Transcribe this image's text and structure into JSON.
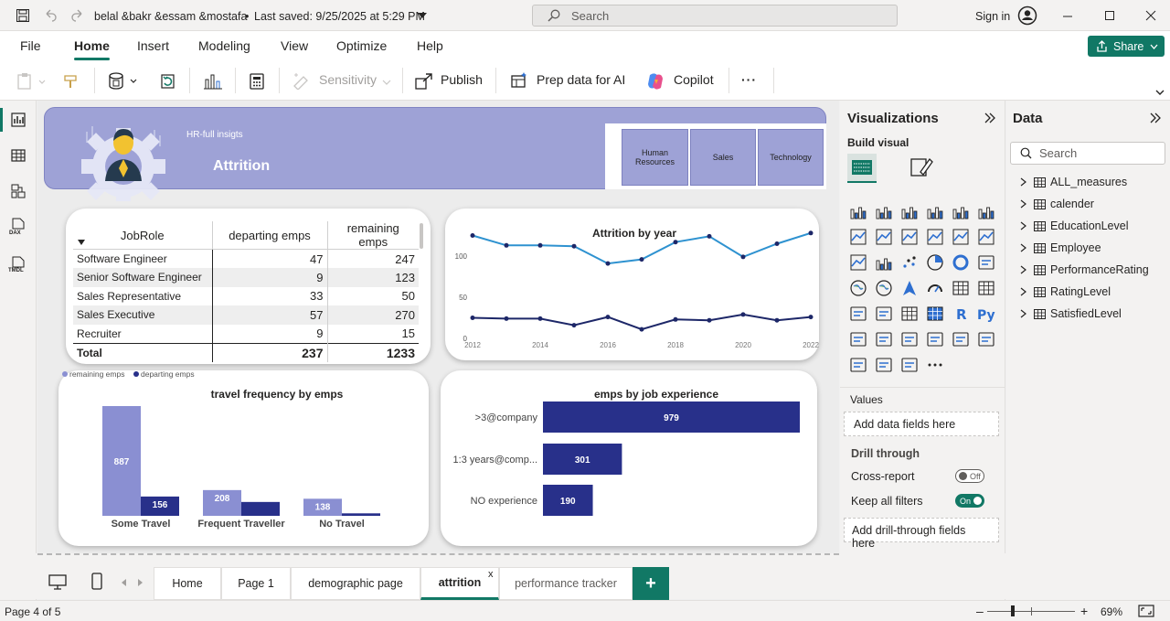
{
  "titlebar": {
    "file_title": "belal &bakr &essam &mostafa",
    "saved": "Last saved: 9/25/2025 at 5:29 PM",
    "search_placeholder": "Search",
    "sign_in": "Sign in"
  },
  "menu": {
    "items": [
      "File",
      "Home",
      "Insert",
      "Modeling",
      "View",
      "Optimize",
      "Help"
    ],
    "share": "Share"
  },
  "ribbon": {
    "sensitivity": "Sensitivity",
    "publish": "Publish",
    "prep_data": "Prep data for AI",
    "copilot": "Copilot",
    "more": "···"
  },
  "rail": {
    "dax": "DAX",
    "tmdl": "TMDL"
  },
  "report": {
    "header_subtitle": "HR-full insigts",
    "header_title": "Attrition",
    "slicer": [
      "Human Resources",
      "Sales",
      "Technology"
    ]
  },
  "table": {
    "columns": [
      "JobRole",
      "departing emps",
      "remaining emps"
    ],
    "rows": [
      [
        "Software Engineer",
        "47",
        "247"
      ],
      [
        "Senior Software Engineer",
        "9",
        "123"
      ],
      [
        "Sales Representative",
        "33",
        "50"
      ],
      [
        "Sales Executive",
        "57",
        "270"
      ],
      [
        "Recruiter",
        "9",
        "15"
      ]
    ],
    "total": [
      "Total",
      "237",
      "1233"
    ]
  },
  "chart_data": [
    {
      "type": "line",
      "title": "Attrition by year",
      "x": [
        2012,
        2013,
        2014,
        2015,
        2016,
        2017,
        2018,
        2019,
        2020,
        2021,
        2022
      ],
      "x_ticks": [
        "2012",
        "2014",
        "2016",
        "2018",
        "2020",
        "2022"
      ],
      "y_ticks": [
        "0",
        "50",
        "100"
      ],
      "ylim": [
        0,
        130
      ],
      "series": [
        {
          "values": [
            125,
            113,
            113,
            112,
            91,
            96,
            117,
            124,
            99,
            115,
            128
          ],
          "color": "#2e92d0"
        },
        {
          "values": [
            25,
            24,
            24,
            16,
            26,
            11,
            23,
            22,
            29,
            22,
            26
          ],
          "color": "#1d2768"
        }
      ],
      "grid": false
    },
    {
      "type": "bar",
      "title": "travel frequency by emps",
      "categories": [
        "Some Travel",
        "Frequent Traveller",
        "No Travel"
      ],
      "series": [
        {
          "name": "remaining emps",
          "values": [
            887,
            208,
            138
          ],
          "color": "#8a8fd2"
        },
        {
          "name": "departing emps",
          "values": [
            156,
            112,
            20
          ],
          "color": "#28308a"
        }
      ],
      "data_labels": {
        "remaining emps": [
          "887",
          "208",
          "138"
        ],
        "departing emps": [
          "156",
          "",
          ""
        ]
      },
      "legend": "top-left",
      "ylim": [
        0,
        887
      ]
    },
    {
      "type": "bar",
      "orientation": "horizontal",
      "title": "emps by job experience",
      "categories": [
        ">3@company",
        "1:3 years@comp...",
        "NO experience"
      ],
      "values": [
        979,
        301,
        190
      ],
      "color": "#28308a",
      "xlim": [
        0,
        979
      ]
    }
  ],
  "viz_pane": {
    "title": "Visualizations",
    "build_visual": "Build visual",
    "values_label": "Values",
    "values_well": "Add data fields here",
    "drill_through": "Drill through",
    "cross_report": "Cross-report",
    "cross_report_state": "Off",
    "keep_filters": "Keep all filters",
    "keep_filters_state": "On",
    "drill_well": "Add drill-through fields here"
  },
  "data_pane": {
    "title": "Data",
    "search_placeholder": "Search",
    "tables": [
      "ALL_measures",
      "calender",
      "EducationLevel",
      "Employee",
      "PerformanceRating",
      "RatingLevel",
      "SatisfiedLevel"
    ]
  },
  "pages": {
    "tabs": [
      "Home",
      "Page 1",
      "demographic page",
      "attrition",
      "performance tracker"
    ],
    "active": "attrition",
    "add": "+"
  },
  "status": {
    "page": "Page 4 of 5",
    "zoom": "69%"
  },
  "colors": {
    "accent": "#117865",
    "header": "#9ea2d6",
    "dark_bar": "#28308a",
    "light_bar": "#8a8fd2"
  }
}
